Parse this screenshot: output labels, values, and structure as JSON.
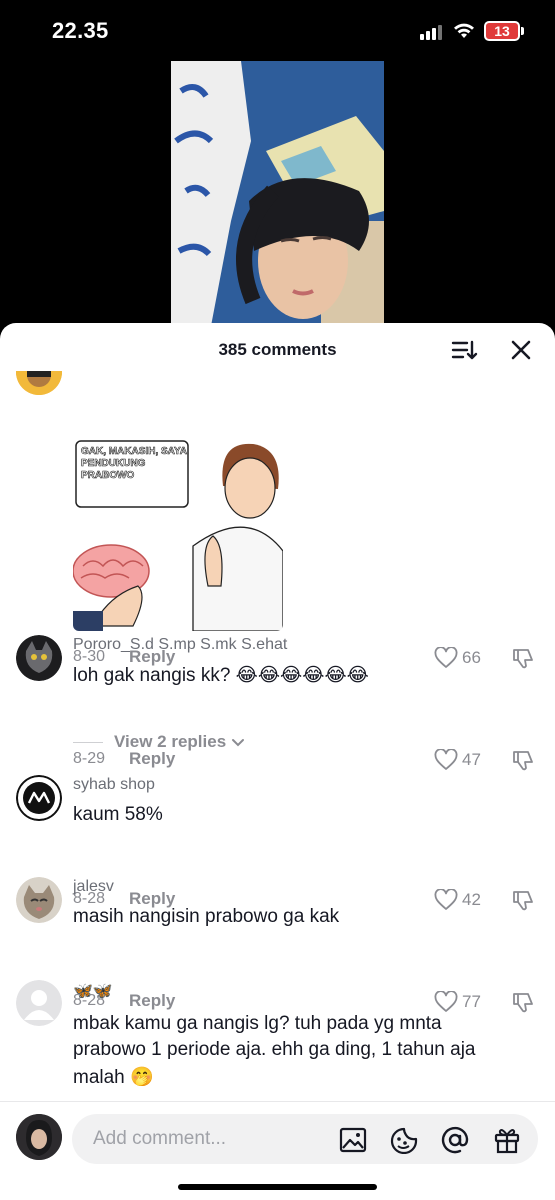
{
  "status": {
    "time": "22.35",
    "battery": "13"
  },
  "sheet": {
    "title": "385 comments"
  },
  "meme": {
    "caption": "GAK, MAKASIH, SAYA PENDUKUNG PRABOWO"
  },
  "comments": [
    {
      "username": "",
      "text": "",
      "date": "8-30",
      "reply": "Reply",
      "likes": "66"
    },
    {
      "username": "Pororo_S.d S.mp S.mk S.ehat",
      "text": "loh gak nangis kk? 😂😂😂😂😂😂",
      "date": "8-29",
      "reply": "Reply",
      "likes": "47",
      "view_replies": "View 2 replies"
    },
    {
      "username": "syhab shop",
      "text": "kaum 58%",
      "date": "8-28",
      "reply": "Reply",
      "likes": "42"
    },
    {
      "username": "jalesv",
      "text": "masih nangisin prabowo ga kak",
      "date": "8-28",
      "reply": "Reply",
      "likes": "77"
    },
    {
      "username": "🦋🦋",
      "text_lines": [
        "mbak kamu ga nangis lg? tuh pada yg mnta",
        "prabowo 1 periode aja. ehh ga ding, 1 tahun aja",
        "malah 🤭"
      ]
    }
  ],
  "composer": {
    "placeholder": "Add comment..."
  },
  "icons": [
    "sort-icon",
    "close-icon",
    "heart-icon",
    "dislike-icon",
    "chevron-down-icon",
    "image-icon",
    "emoji-icon",
    "at-icon",
    "gift-icon"
  ]
}
